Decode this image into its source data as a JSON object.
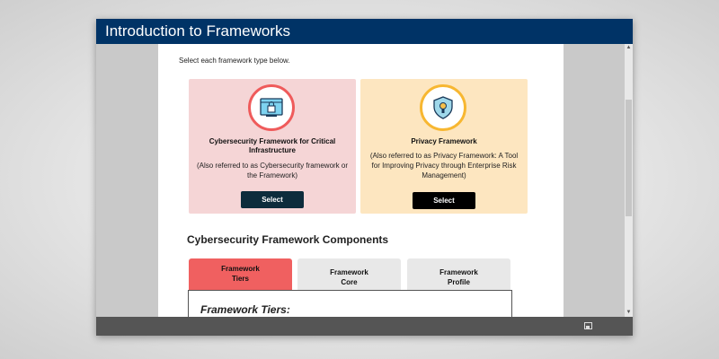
{
  "window": {
    "title": "Introduction to Frameworks"
  },
  "content": {
    "instruction": "Select each framework type below.",
    "cards": [
      {
        "icon": "computer-lock-icon",
        "title": "Cybersecurity Framework for Critical Infrastructure",
        "subtitle": "(Also referred to as Cybersecurity framework or the Framework)",
        "button_label": "Select",
        "accent": "#ef5b5b",
        "background": "#f5d5d6"
      },
      {
        "icon": "shield-icon",
        "title": "Privacy Framework",
        "subtitle": "(Also referred to as Privacy Framework: A Tool for Improving Privacy through Enterprise Risk Management)",
        "button_label": "Select",
        "accent": "#f7b731",
        "background": "#fde6c0"
      }
    ],
    "section_heading": "Cybersecurity Framework Components",
    "tabs": [
      {
        "label_line1": "Framework",
        "label_line2": "Tiers",
        "active": true
      },
      {
        "label_line1": "Framework",
        "label_line2": "Core",
        "active": false
      },
      {
        "label_line1": "Framework",
        "label_line2": "Profile",
        "active": false
      }
    ],
    "panel_title": "Framework Tiers:"
  },
  "footer": {
    "icon": "fullscreen-icon"
  },
  "colors": {
    "titlebar": "#003366",
    "active_tab": "#f06060",
    "footer": "#555555"
  }
}
